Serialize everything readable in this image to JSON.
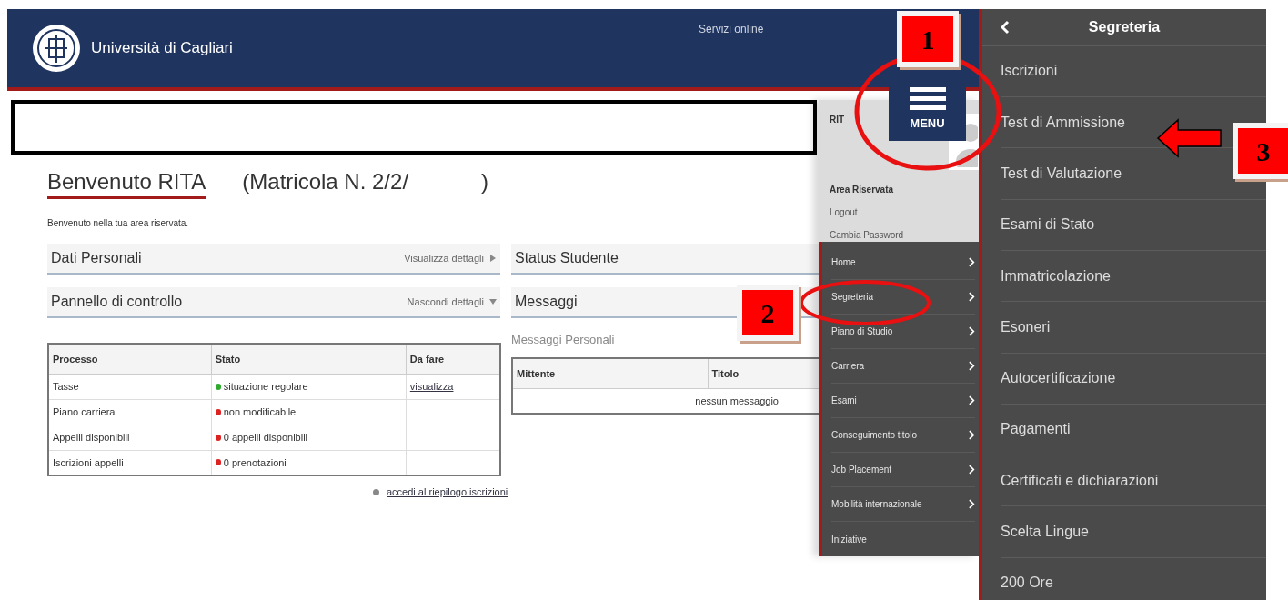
{
  "header": {
    "title": "Università di Cagliari",
    "services_link": "Servizi online"
  },
  "menu_button": {
    "label": "MENU"
  },
  "welcome": {
    "title": "Benvenuto RITA",
    "matricola": "(Matricola N. 2/2/",
    "matricola_end": ")",
    "subtitle": "Benvenuto nella tua area riservata."
  },
  "left_sections": [
    {
      "title": "Dati Personali",
      "action": "Visualizza dettagli",
      "expanded": false
    },
    {
      "title": "Pannello di controllo",
      "action": "Nascondi dettagli",
      "expanded": true
    }
  ],
  "control_table": {
    "columns": [
      "Processo",
      "Stato",
      "Da fare"
    ],
    "rows": [
      {
        "process": "Tasse",
        "status": "situazione regolare",
        "color": "#2eaa2e",
        "action": "visualizza"
      },
      {
        "process": "Piano carriera",
        "status": "non modificabile",
        "color": "#dd2222"
      },
      {
        "process": "Appelli disponibili",
        "status": "0 appelli disponibili",
        "color": "#dd2222"
      },
      {
        "process": "Iscrizioni appelli",
        "status": "0 prenotazioni",
        "color": "#dd2222"
      }
    ]
  },
  "summary_link": "accedi al riepilogo iscrizioni",
  "right_sections": [
    {
      "title": "Status Studente"
    },
    {
      "title": "Messaggi"
    }
  ],
  "messages": {
    "subtitle": "Messaggi Personali",
    "columns": [
      "Mittente",
      "Titolo"
    ],
    "empty": "nessun messaggio"
  },
  "side_menu": {
    "user": "RIT",
    "area_title": "Area Riservata",
    "links": [
      "Logout",
      "Cambia Password"
    ],
    "items": [
      {
        "label": "Home",
        "submenu": true
      },
      {
        "label": "Segreteria",
        "submenu": true
      },
      {
        "label": "Piano di Studio",
        "submenu": true
      },
      {
        "label": "Carriera",
        "submenu": true
      },
      {
        "label": "Esami",
        "submenu": true
      },
      {
        "label": "Conseguimento titolo",
        "submenu": true
      },
      {
        "label": "Job Placement",
        "submenu": true
      },
      {
        "label": "Mobilità internazionale",
        "submenu": true
      },
      {
        "label": "Iniziative",
        "submenu": false
      }
    ]
  },
  "submenu": {
    "title": "Segreteria",
    "items": [
      "Iscrizioni",
      "Test di Ammissione",
      "Test di Valutazione",
      "Esami di Stato",
      "Immatricolazione",
      "Esoneri",
      "Autocertificazione",
      "Pagamenti",
      "Certificati e dichiarazioni",
      "Scelta Lingue",
      "200 Ore"
    ]
  },
  "callouts": [
    "1",
    "2",
    "3"
  ]
}
